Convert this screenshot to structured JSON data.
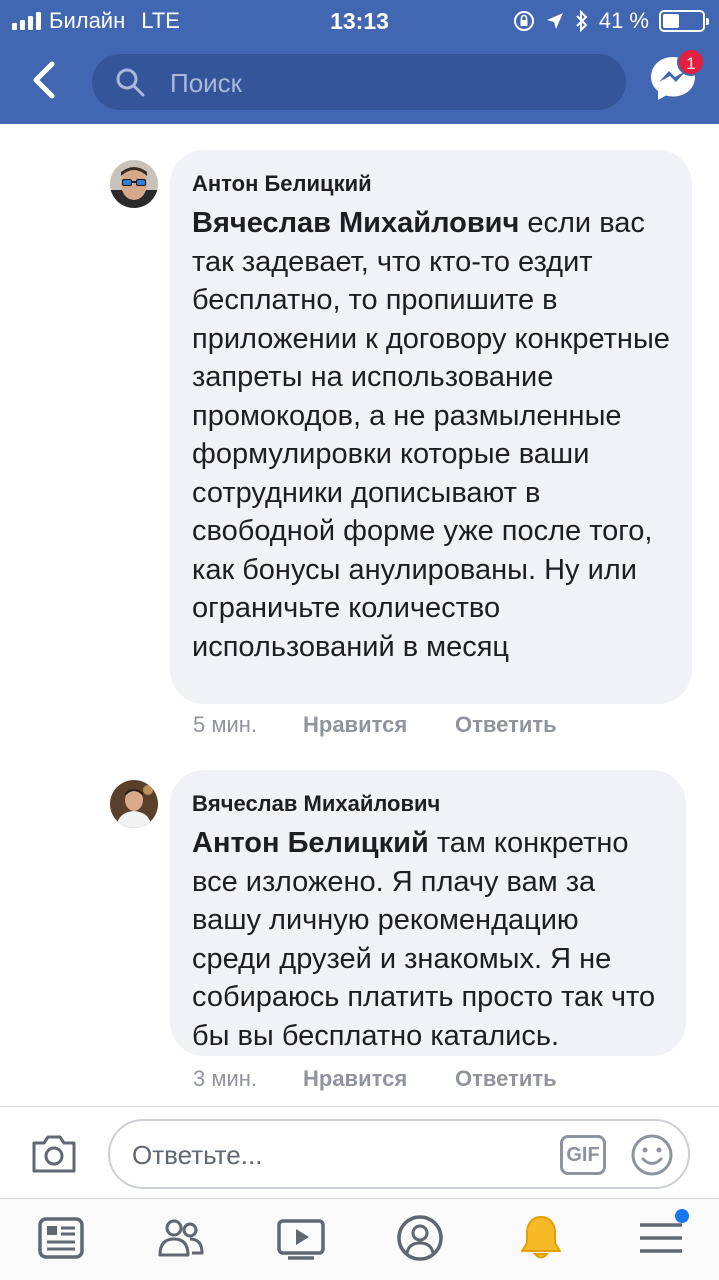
{
  "status_bar": {
    "carrier": "Билайн",
    "network": "LTE",
    "time": "13:13",
    "battery": "41 %"
  },
  "nav": {
    "search_placeholder": "Поиск",
    "messenger_badge": "1"
  },
  "comments": [
    {
      "author": "Антон Белицкий",
      "mention": "Вячеслав Михайлович",
      "text": " если вас так задевает, что кто-то ездит бесплатно, то пропишите в приложении к договору конкретные запреты на использование промокодов, а не размыленные формулировки которые ваши сотрудники дописывают в свободной форме уже после того, как бонусы анулированы. Ну или ограничьте количество использований в месяц",
      "time": "5 мин.",
      "like": "Нравится",
      "reply": "Ответить"
    },
    {
      "author": "Вячеслав Михайлович",
      "mention": "Антон Белицкий",
      "text": " там конкретно все изложено. Я плачу вам за вашу личную рекомендацию среди друзей и знакомых. Я не собираюсь платить просто так что бы вы бесплатно катались.",
      "time": "3 мин.",
      "like": "Нравится",
      "reply": "Ответить"
    }
  ],
  "reply_bar": {
    "placeholder": "Ответьте...",
    "gif_label": "GIF"
  },
  "tabbar": {
    "icons": [
      "news-feed-icon",
      "friends-icon",
      "watch-icon",
      "profile-icon",
      "notifications-icon",
      "menu-icon"
    ]
  },
  "colors": {
    "brand": "#4267b2",
    "bubble": "#f1f2f6",
    "badge": "#e41e3f",
    "notification_active": "#f7b928"
  }
}
